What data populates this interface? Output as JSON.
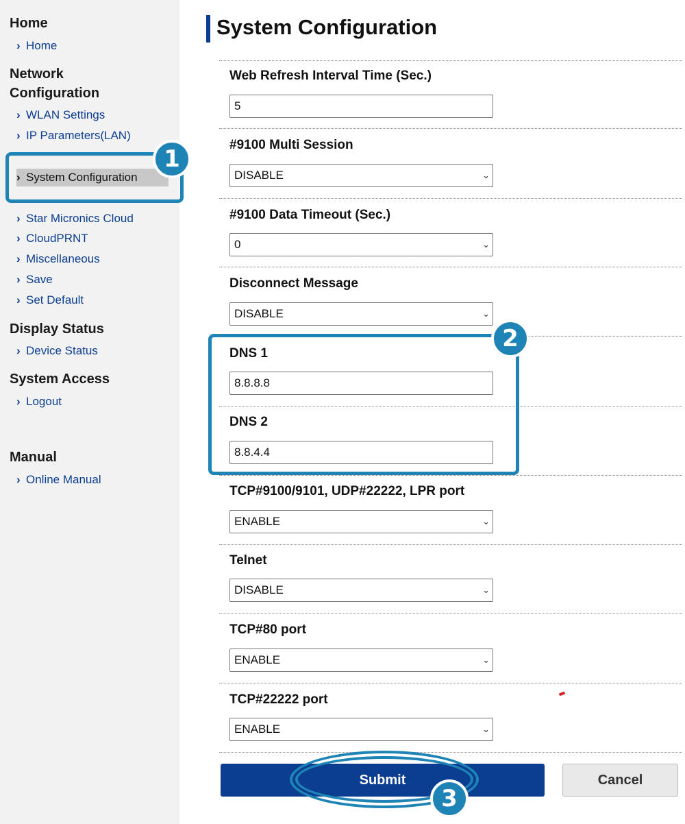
{
  "sidebar": {
    "sections": [
      {
        "title": "Home",
        "items": [
          "Home"
        ]
      },
      {
        "title": "Network Configuration",
        "items": [
          "WLAN Settings",
          "IP Parameters(LAN)",
          "System Configuration",
          "Star Micronics Cloud",
          "CloudPRNT",
          "Miscellaneous",
          "Save",
          "Set Default"
        ]
      },
      {
        "title": "Display Status",
        "items": [
          "Device Status"
        ]
      },
      {
        "title": "System Access",
        "items": [
          "Logout"
        ]
      },
      {
        "title": "Manual",
        "items": [
          "Online Manual"
        ]
      }
    ],
    "network_title_line1": "Network",
    "network_title_line2": "Configuration",
    "active_item": "System Configuration"
  },
  "main": {
    "title": "System Configuration",
    "fields": [
      {
        "label": "Web Refresh Interval Time (Sec.)",
        "type": "text",
        "value": "5"
      },
      {
        "label": "#9100 Multi Session",
        "type": "select",
        "value": "DISABLE"
      },
      {
        "label": "#9100 Data Timeout (Sec.)",
        "type": "select",
        "value": "0"
      },
      {
        "label": "Disconnect Message",
        "type": "select",
        "value": "DISABLE"
      },
      {
        "label": "DNS 1",
        "type": "text",
        "value": "8.8.8.8"
      },
      {
        "label": "DNS 2",
        "type": "text",
        "value": "8.8.4.4"
      },
      {
        "label": "TCP#9100/9101, UDP#22222, LPR port",
        "type": "select",
        "value": "ENABLE"
      },
      {
        "label": "Telnet",
        "type": "select",
        "value": "DISABLE"
      },
      {
        "label": "TCP#80 port",
        "type": "select",
        "value": "ENABLE"
      },
      {
        "label": "TCP#22222 port",
        "type": "select",
        "value": "ENABLE"
      }
    ],
    "submit_label": "Submit",
    "cancel_label": "Cancel"
  },
  "annotations": {
    "step1": "1",
    "step2": "2",
    "step3": "3",
    "color": "#1e84b5"
  },
  "colors": {
    "brand": "#0b3d91",
    "sidebar_bg": "#f2f2f2"
  }
}
